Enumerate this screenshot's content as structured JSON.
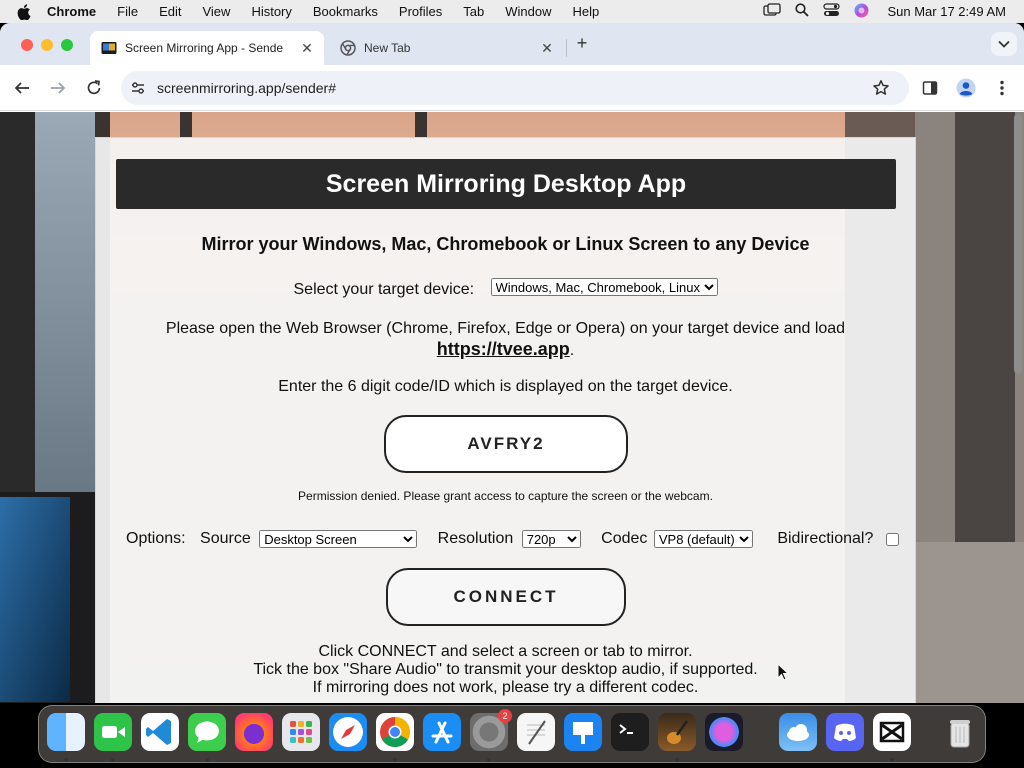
{
  "menubar": {
    "app": "Chrome",
    "items": [
      "File",
      "Edit",
      "View",
      "History",
      "Bookmarks",
      "Profiles",
      "Tab",
      "Window",
      "Help"
    ],
    "clock": "Sun Mar 17  2:49 AM"
  },
  "tabs": [
    {
      "title": "Screen Mirroring App - Sende",
      "active": true
    },
    {
      "title": "New Tab",
      "active": false
    }
  ],
  "toolbar": {
    "url": "screenmirroring.app/sender#"
  },
  "page": {
    "header": "Screen Mirroring Desktop App",
    "subtitle": "Mirror your Windows, Mac, Chromebook or Linux Screen to any Device",
    "device_label": "Select your target device:",
    "device_value": "Windows, Mac, Chromebook, Linux",
    "instructions": "Please open the Web Browser (Chrome, Firefox, Edge or Opera) on your target device and load",
    "link": "https://tvee.app",
    "link_suffix": ".",
    "code_label": "Enter the 6 digit code/ID which is displayed on the target device.",
    "code_value": "AVFRY2",
    "permission": "Permission denied. Please grant access to capture the screen or the webcam.",
    "options": {
      "label": "Options:",
      "source_label": "Source",
      "source_value": "Desktop Screen",
      "resolution_label": "Resolution",
      "resolution_value": "720p",
      "codec_label": "Codec",
      "codec_value": "VP8 (default)",
      "bidirectional_label": "Bidirectional?",
      "bidirectional_checked": false
    },
    "connect": "CONNECT",
    "help": [
      "Click CONNECT and select a screen or tab to mirror.",
      "Tick the box \"Share Audio\" to transmit your desktop audio, if supported.",
      "If mirroring does not work, please try a different codec."
    ]
  },
  "dock": {
    "system_prefs_badge": "2",
    "apps": [
      "finder-icon",
      "facetime-icon",
      "vscode-icon",
      "messages-icon",
      "firefox-icon",
      "launchpad-icon",
      "safari-icon",
      "chrome-icon",
      "app-store-icon",
      "system-settings-icon",
      "textedit-icon",
      "keynote-icon",
      "terminal-icon",
      "garageband-icon",
      "siri-icon",
      "weather-icon",
      "discord-icon",
      "capcut-icon",
      "trash-icon"
    ]
  }
}
